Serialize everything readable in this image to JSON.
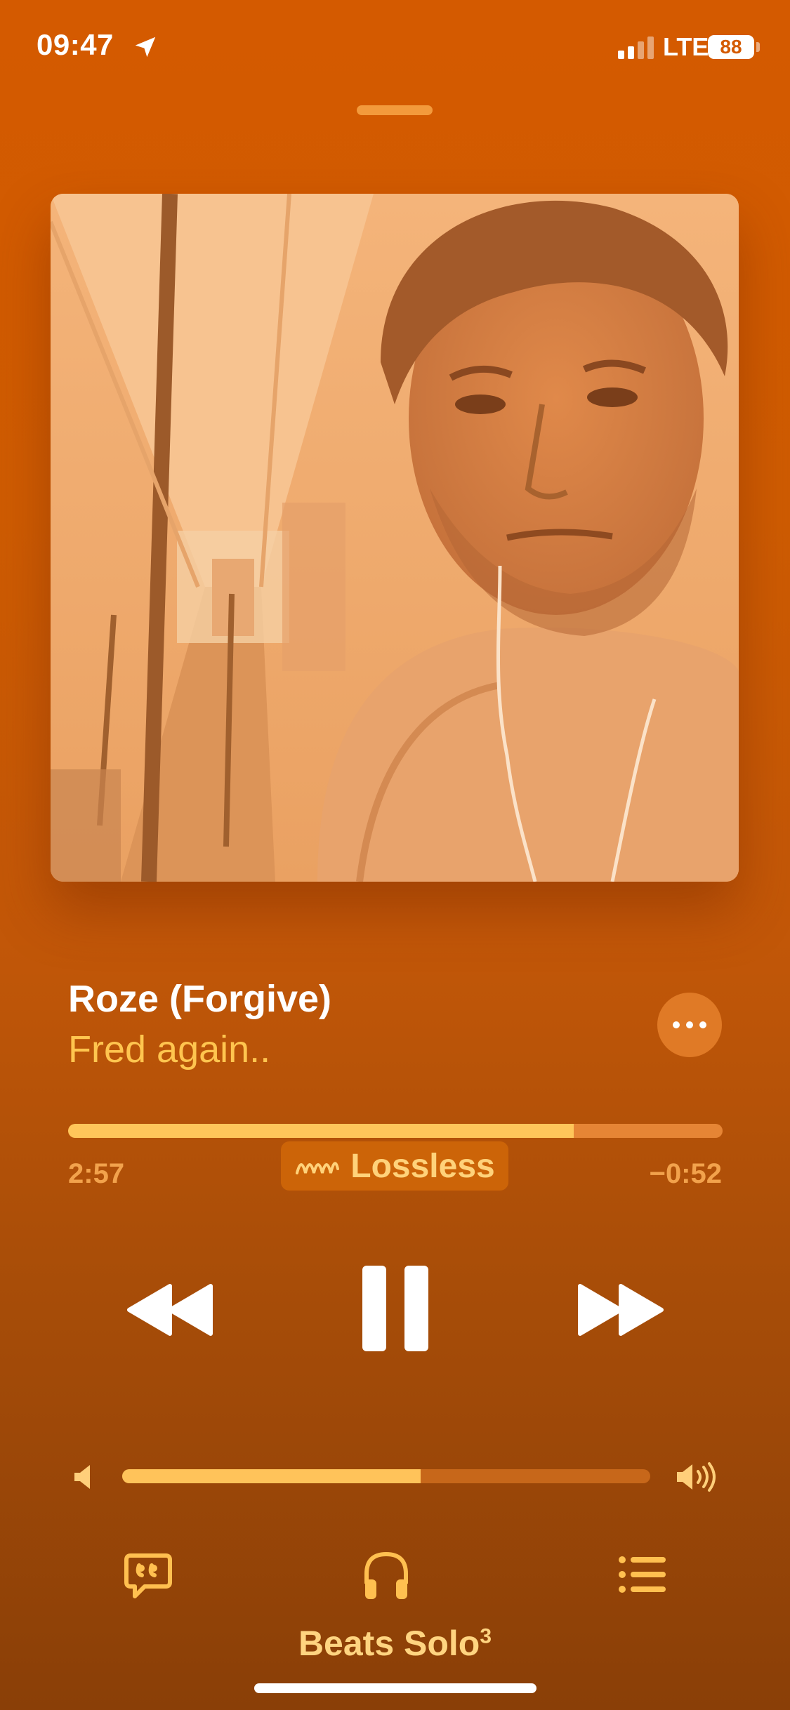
{
  "status_bar": {
    "time": "09:47",
    "network": "LTE",
    "battery": "88",
    "signal_bars_active": 2,
    "signal_bars_total": 4
  },
  "track": {
    "title": "Roze (Forgive)",
    "artist": "Fred again.."
  },
  "playback": {
    "elapsed": "2:57",
    "remaining": "−0:52",
    "progress": 0.773,
    "quality_label": "Lossless",
    "state": "playing"
  },
  "volume": {
    "level": 0.565
  },
  "output": {
    "device_name": "Beats Solo",
    "device_superscript": "3"
  },
  "colors": {
    "background_top": "#d45a00",
    "background_bottom": "#8a3f07",
    "accent": "#ffc54f",
    "progress_fill": "#ffc65a"
  },
  "icons": {
    "location": "location-arrow-icon",
    "more": "ellipsis-icon",
    "lossless": "lossless-wave-icon",
    "rewind": "rewind-icon",
    "pause": "pause-icon",
    "forward": "fast-forward-icon",
    "volume_low": "speaker-low-icon",
    "volume_high": "speaker-high-icon",
    "lyrics": "lyrics-quote-icon",
    "airplay": "headphones-icon",
    "queue": "queue-list-icon"
  }
}
